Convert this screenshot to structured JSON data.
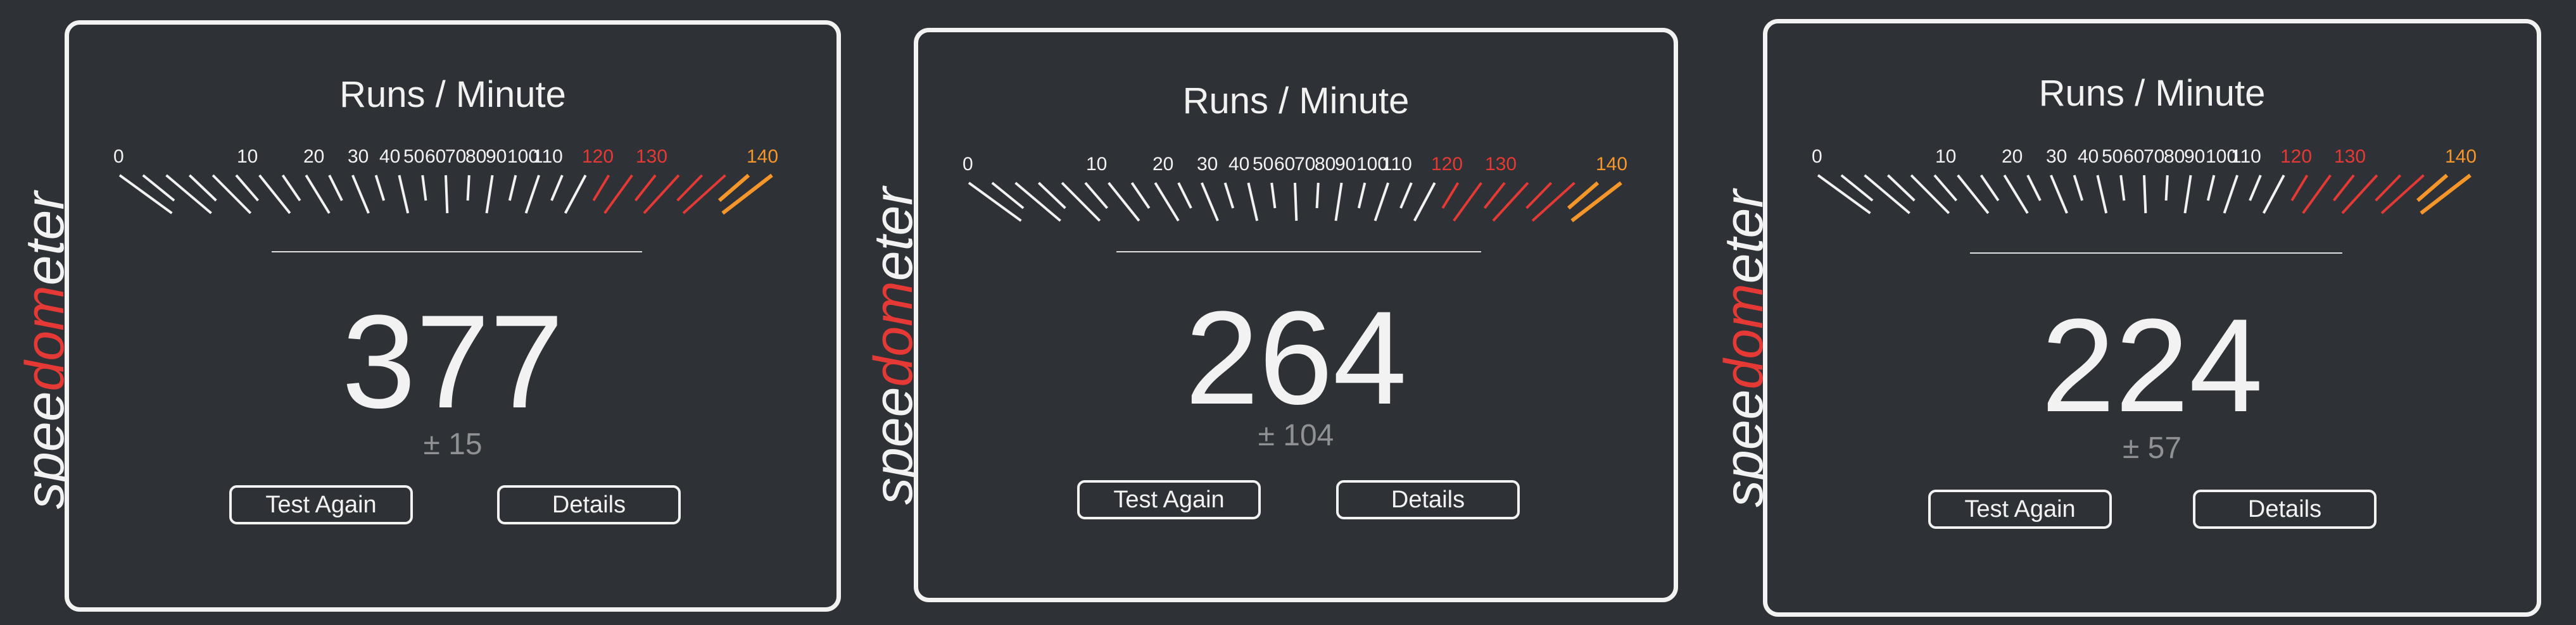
{
  "brand": {
    "wordmark_parts": [
      "spee",
      "dom",
      "eter"
    ],
    "accent_color": "#e53935",
    "text_color": "#f2f2f2"
  },
  "gauge": {
    "tick_labels": [
      "0",
      "10",
      "20",
      "30",
      "40",
      "50",
      "60",
      "70",
      "80",
      "90",
      "100",
      "110",
      "120",
      "130",
      "140"
    ],
    "normal_color": "#f2f2f2",
    "warning_color": "#e53935",
    "max_color": "#f5962a"
  },
  "panels": [
    {
      "title": "Runs / Minute",
      "score": "377",
      "error": "± 15",
      "test_again_label": "Test Again",
      "details_label": "Details"
    },
    {
      "title": "Runs / Minute",
      "score": "264",
      "error": "± 104",
      "test_again_label": "Test Again",
      "details_label": "Details"
    },
    {
      "title": "Runs / Minute",
      "score": "224",
      "error": "± 57",
      "test_again_label": "Test Again",
      "details_label": "Details"
    }
  ]
}
